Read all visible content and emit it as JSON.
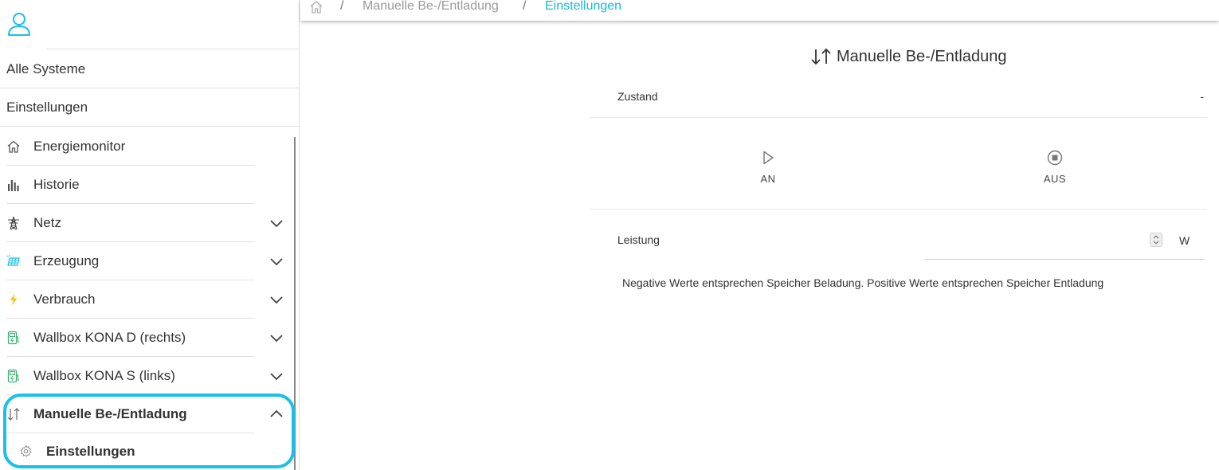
{
  "sidebar": {
    "top_links": [
      "Alle Systeme",
      "Einstellungen"
    ],
    "items": [
      {
        "label": "Energiemonitor",
        "icon": "home-icon"
      },
      {
        "label": "Historie",
        "icon": "bar-chart-icon"
      },
      {
        "label": "Netz",
        "icon": "power-pylon-icon",
        "expandable": true
      },
      {
        "label": "Erzeugung",
        "icon": "solar-panel-icon",
        "expandable": true
      },
      {
        "label": "Verbrauch",
        "icon": "lightning-icon",
        "expandable": true
      },
      {
        "label": "Wallbox KONA D (rechts)",
        "icon": "wallbox-icon",
        "expandable": true
      },
      {
        "label": "Wallbox KONA S (links)",
        "icon": "wallbox-icon",
        "expandable": true
      },
      {
        "label": "Manuelle Be-/Entladung",
        "icon": "up-down-arrows-icon",
        "expandable": true,
        "expanded": true
      }
    ],
    "subitem": {
      "label": "Einstellungen",
      "icon": "gear-icon"
    }
  },
  "breadcrumb": {
    "separator": "/",
    "parent": "Manuelle Be-/Entladung",
    "current": "Einstellungen"
  },
  "panel": {
    "title": "Manuelle Be-/Entladung",
    "zustand": {
      "label": "Zustand",
      "value": "-"
    },
    "buttons": {
      "on": "AN",
      "off": "AUS"
    },
    "leistung": {
      "label": "Leistung",
      "value": "",
      "placeholder": "",
      "unit": "W"
    },
    "hint": "Negative Werte entsprechen Speicher Beladung. Positive Werte entsprechen Speicher Entladung"
  },
  "colors": {
    "accent": "#19c0e8",
    "verbrauch_icon": "#f5c518",
    "wallbox_icon": "#3cb371"
  }
}
